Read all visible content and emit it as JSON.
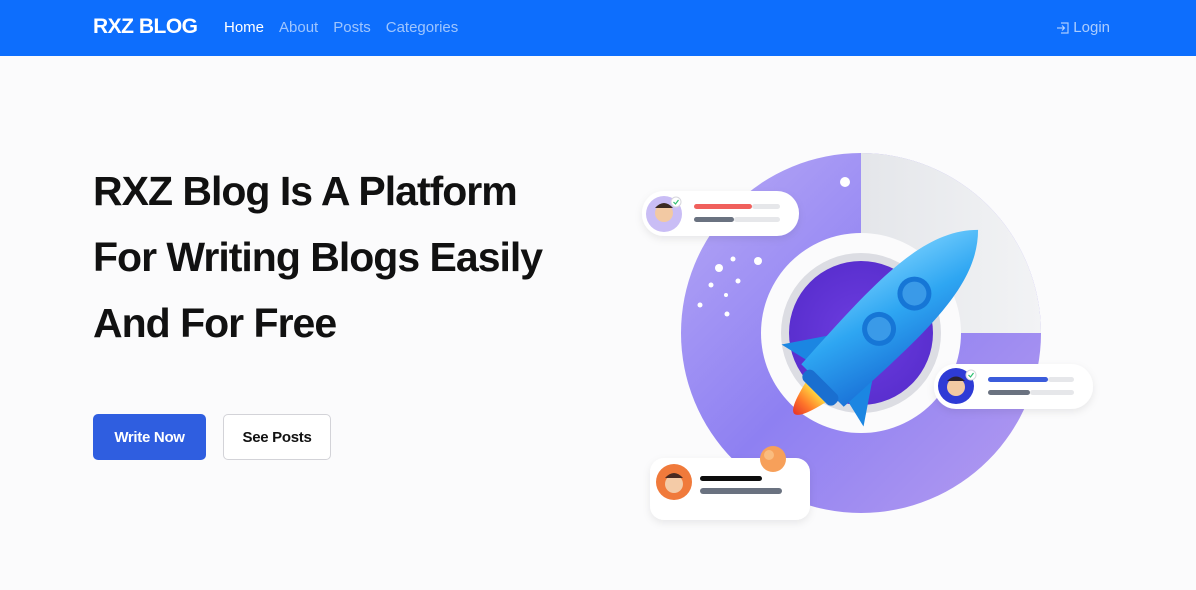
{
  "navbar": {
    "brand": "RXZ BLOG",
    "links": [
      {
        "label": "Home",
        "active": true
      },
      {
        "label": "About",
        "active": false
      },
      {
        "label": "Posts",
        "active": false
      },
      {
        "label": "Categories",
        "active": false
      }
    ],
    "login_label": "Login",
    "login_icon": "login-icon"
  },
  "hero": {
    "title_lines": [
      "RXZ Blog Is A Platform",
      "For Writing Blogs Easily",
      "And For Free"
    ],
    "primary_button": "Write Now",
    "secondary_button": "See Posts"
  },
  "colors": {
    "navbar_bg": "#0d6efd",
    "primary_button": "#2f5ee0",
    "ring_purple": "#8e80f2",
    "rocket_blue": "#2ea6f2"
  }
}
